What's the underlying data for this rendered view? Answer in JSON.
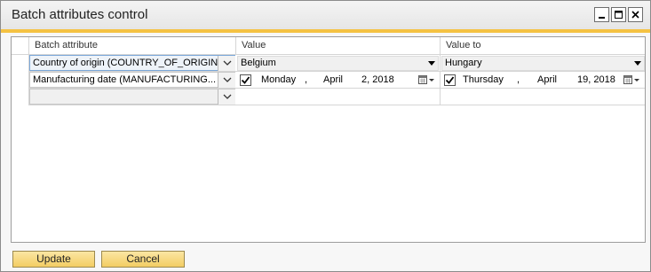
{
  "window": {
    "title": "Batch attributes control"
  },
  "grid": {
    "columns": [
      "Batch attribute",
      "Value",
      "Value to"
    ],
    "rows": [
      {
        "attribute": "Country of origin (COUNTRY_OF_ORIGIN)",
        "value": "Belgium",
        "value_to": "Hungary"
      },
      {
        "attribute": "Manufacturing date (MANUFACTURING...",
        "value_date": {
          "weekday": "Monday",
          "sep1": ",",
          "month": "April",
          "day_year": "2, 2018",
          "checked": true
        },
        "value_to_date": {
          "weekday": "Thursday",
          "sep1": ",",
          "month": "April",
          "day_year": "19, 2018",
          "checked": true
        }
      },
      {
        "attribute": ""
      }
    ]
  },
  "buttons": {
    "update": "Update",
    "cancel": "Cancel"
  },
  "colors": {
    "accent": "#f5c242",
    "button": "#f3cd63",
    "selection_border": "#7aa7d9"
  }
}
